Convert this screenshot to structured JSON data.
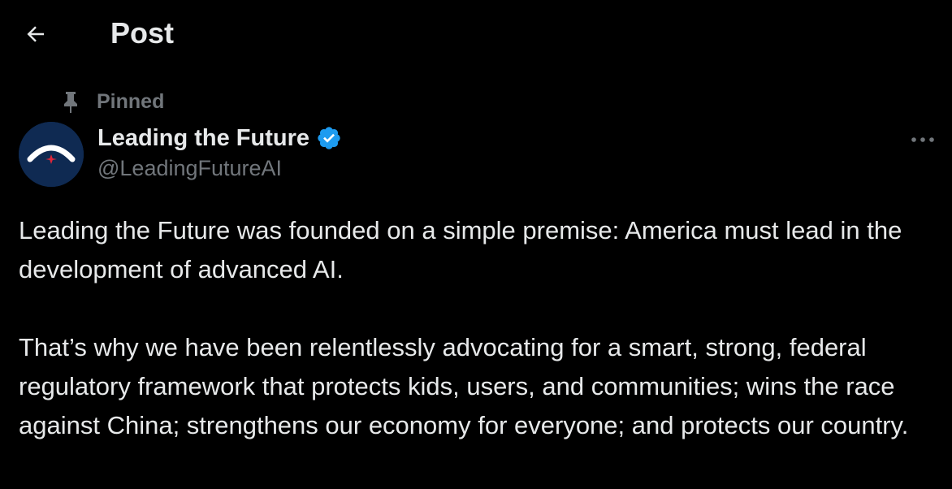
{
  "header": {
    "title": "Post"
  },
  "pinned": {
    "label": "Pinned"
  },
  "author": {
    "name": "Leading the Future",
    "handle": "@LeadingFutureAI",
    "verified": true
  },
  "post": {
    "paragraphs": [
      "Leading the Future was founded on a simple premise: America must lead in the development of advanced AI.",
      "That’s why we have been relentlessly advocating for a smart, strong, federal regulatory framework that protects kids, users, and communities; wins the race against China; strengthens our economy for everyone; and protects our country."
    ]
  },
  "icons": {
    "back": "arrow-left-icon",
    "pin": "pin-icon",
    "verified": "verified-badge-icon",
    "more": "more-horizontal-icon"
  },
  "colors": {
    "background": "#000000",
    "text_primary": "#e7e9ea",
    "text_secondary": "#71767b",
    "verified_blue": "#1d9bf0",
    "avatar_navy": "#0f2a52",
    "avatar_red": "#e0263a"
  }
}
